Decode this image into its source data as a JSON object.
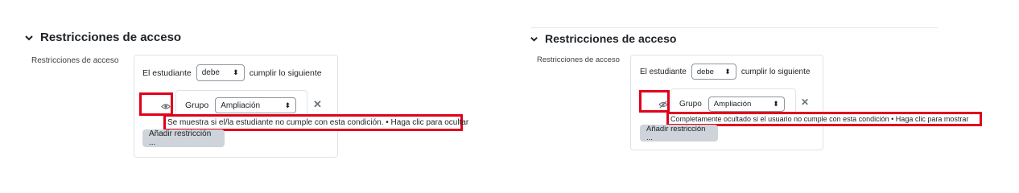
{
  "panels": [
    {
      "section_title": "Restricciones de acceso",
      "field_label": "Restricciones de acceso",
      "student_prefix": "El estudiante",
      "must_select": "debe",
      "student_suffix": "cumplir lo siguiente",
      "condition_type": "Grupo",
      "group_select": "Ampliación",
      "eye_icon": "eye-icon",
      "tooltip": "Se muestra si el/la estudiante no cumple con esta condición. • Haga clic para ocultar",
      "add_button": "Añadir restricción ..."
    },
    {
      "section_title": "Restricciones de acceso",
      "field_label": "Restricciones de acceso",
      "student_prefix": "El estudiante",
      "must_select": "debe",
      "student_suffix": "cumplir lo siguiente",
      "condition_type": "Grupo",
      "group_select": "Ampliación",
      "eye_icon": "eye-slash-icon",
      "tooltip": "Completamente ocultado si el usuario no cumple con esta condición • Haga clic para mostrar",
      "add_button": "Añadir restricción ..."
    }
  ],
  "colors": {
    "highlight_red": "#e0001b",
    "text": "#1d2125",
    "muted": "#6a737b",
    "border": "#dee2e6",
    "button_bg": "#ced4da"
  }
}
